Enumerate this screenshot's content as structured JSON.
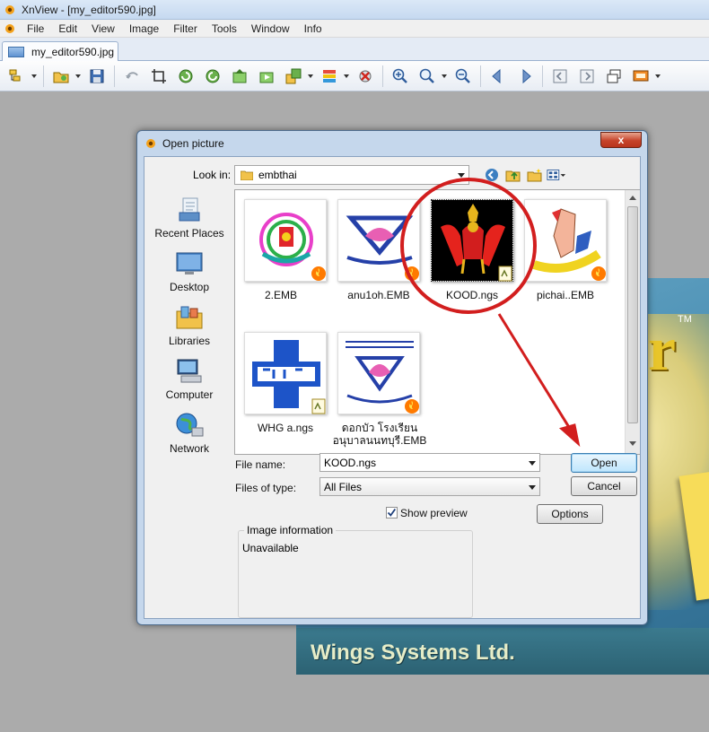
{
  "app": {
    "title": "XnView - [my_editor590.jpg]",
    "menu": [
      "File",
      "Edit",
      "View",
      "Image",
      "Filter",
      "Tools",
      "Window",
      "Info"
    ],
    "tab_label": "my_editor590.jpg"
  },
  "toolbar": {
    "icons": [
      "browser-icon",
      "open-folder-icon",
      "save-icon",
      "undo-icon",
      "crop-icon",
      "rotate-left-icon",
      "rotate-right-icon",
      "prev-image-icon",
      "next-image-icon",
      "resize-icon",
      "color-adjust-icon",
      "settings-icon",
      "zoom-in-icon",
      "zoom-1to1-icon",
      "zoom-out-icon",
      "back-arrow-icon",
      "forward-arrow-icon",
      "page-prev-icon",
      "page-next-icon",
      "window-icon",
      "slideshow-icon"
    ]
  },
  "background_image": {
    "footer_text": "Wings Systems Ltd.",
    "logo_letter": "r",
    "trademark": "TM"
  },
  "dialog": {
    "title": "Open picture",
    "close_label": "x",
    "look_in_label": "Look in:",
    "look_in_value": "embthai",
    "places": [
      "Recent Places",
      "Desktop",
      "Libraries",
      "Computer",
      "Network"
    ],
    "files": [
      {
        "name": "2.EMB",
        "type": "emb"
      },
      {
        "name": "anu1oh.EMB",
        "type": "emb"
      },
      {
        "name": "KOOD.ngs",
        "type": "ngs",
        "selected": true
      },
      {
        "name": "pichai..EMB",
        "type": "emb"
      },
      {
        "name": "WHG a.ngs",
        "type": "ngs"
      },
      {
        "name": "ดอกบัว โรงเรียน อนุบาลนนทบุรี.EMB",
        "type": "emb"
      }
    ],
    "file_name_label": "File name:",
    "file_name_value": "KOOD.ngs",
    "file_type_label": "Files of type:",
    "file_type_value": "All Files",
    "open_button": "Open",
    "cancel_button": "Cancel",
    "show_preview_label": "Show preview",
    "show_preview_checked": true,
    "options_button": "Options",
    "image_info_title": "Image information",
    "image_info_value": "Unavailable"
  },
  "colors": {
    "annotation_red": "#d21e1e",
    "dialog_frame": "#c5d7ec",
    "close_button": "#c6432a"
  }
}
